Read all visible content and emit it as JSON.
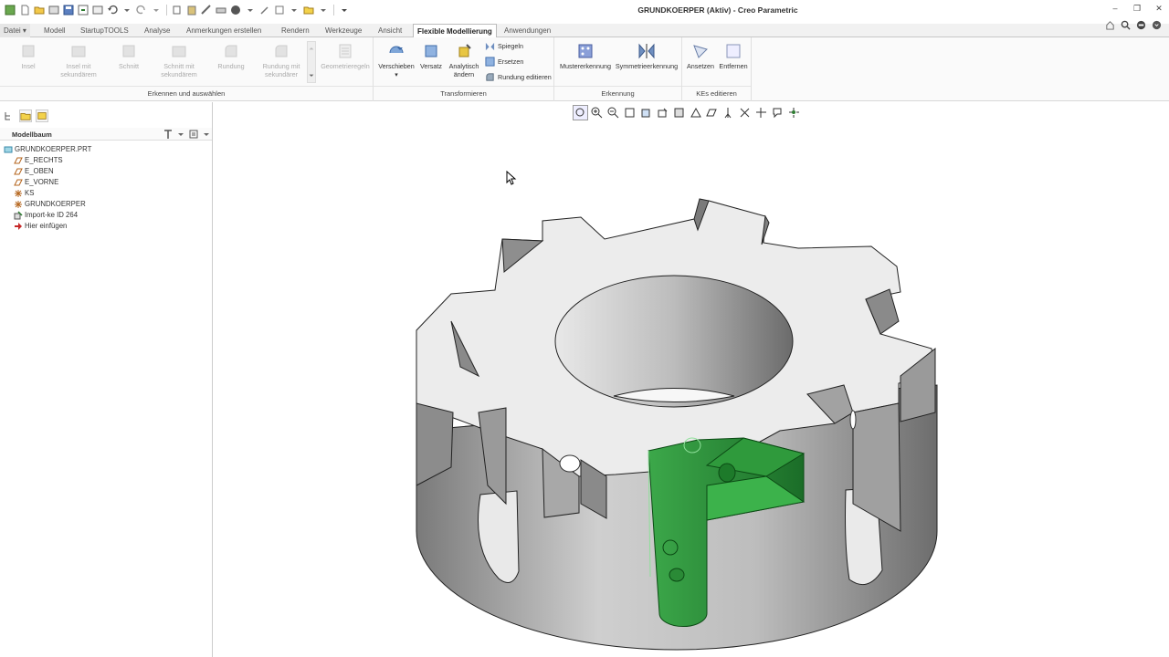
{
  "window": {
    "title": "GRUNDKOERPER (Aktiv) - Creo Parametric"
  },
  "tabs": [
    {
      "label": "Datei ▾"
    },
    {
      "label": "Modell"
    },
    {
      "label": "StartupTOOLS"
    },
    {
      "label": "Analyse"
    },
    {
      "label": "Anmerkungen erstellen"
    },
    {
      "label": "Rendern"
    },
    {
      "label": "Werkzeuge"
    },
    {
      "label": "Ansicht"
    },
    {
      "label": "Flexible Modellierung"
    },
    {
      "label": "Anwendungen"
    }
  ],
  "ribbon": {
    "erkennen": {
      "label": "Erkennen und auswählen",
      "insel": "Insel",
      "insel_sek_1": "Insel mit",
      "insel_sek_2": "sekundärem",
      "schnitt": "Schnitt",
      "schnitt_sek_1": "Schnitt mit",
      "schnitt_sek_2": "sekundärem",
      "rundung": "Rundung",
      "rundung_sek_1": "Rundung mit",
      "rundung_sek_2": "sekundärer",
      "geometrieregeln": "Geometrieregeln"
    },
    "transformieren": {
      "label": "Transformieren",
      "verschieben": "Verschieben",
      "versatz": "Versatz",
      "analytisch_1": "Analytisch",
      "analytisch_2": "ändern",
      "spiegeln": "Spiegeln",
      "ersetzen": "Ersetzen",
      "rundung_editieren": "Rundung editieren"
    },
    "erkennung": {
      "label": "Erkennung",
      "mustererkennung": "Mustererkennung",
      "symmetrieerkennung": "Symmetrieerkennung"
    },
    "kes": {
      "label": "KEs editieren",
      "ansetzen": "Ansetzen",
      "entfernen": "Entfernen"
    }
  },
  "modelltree": {
    "header": "Modellbaum",
    "items": [
      {
        "label": "GRUNDKOERPER.PRT"
      },
      {
        "label": "E_RECHTS"
      },
      {
        "label": "E_OBEN"
      },
      {
        "label": "E_VORNE"
      },
      {
        "label": "KS"
      },
      {
        "label": "GRUNDKOERPER"
      },
      {
        "label": "Import-ke ID 264"
      },
      {
        "label": "Hier einfügen"
      }
    ]
  },
  "colors": {
    "accent": "#2e9a3a",
    "model_gray": "#c8c8c8"
  }
}
